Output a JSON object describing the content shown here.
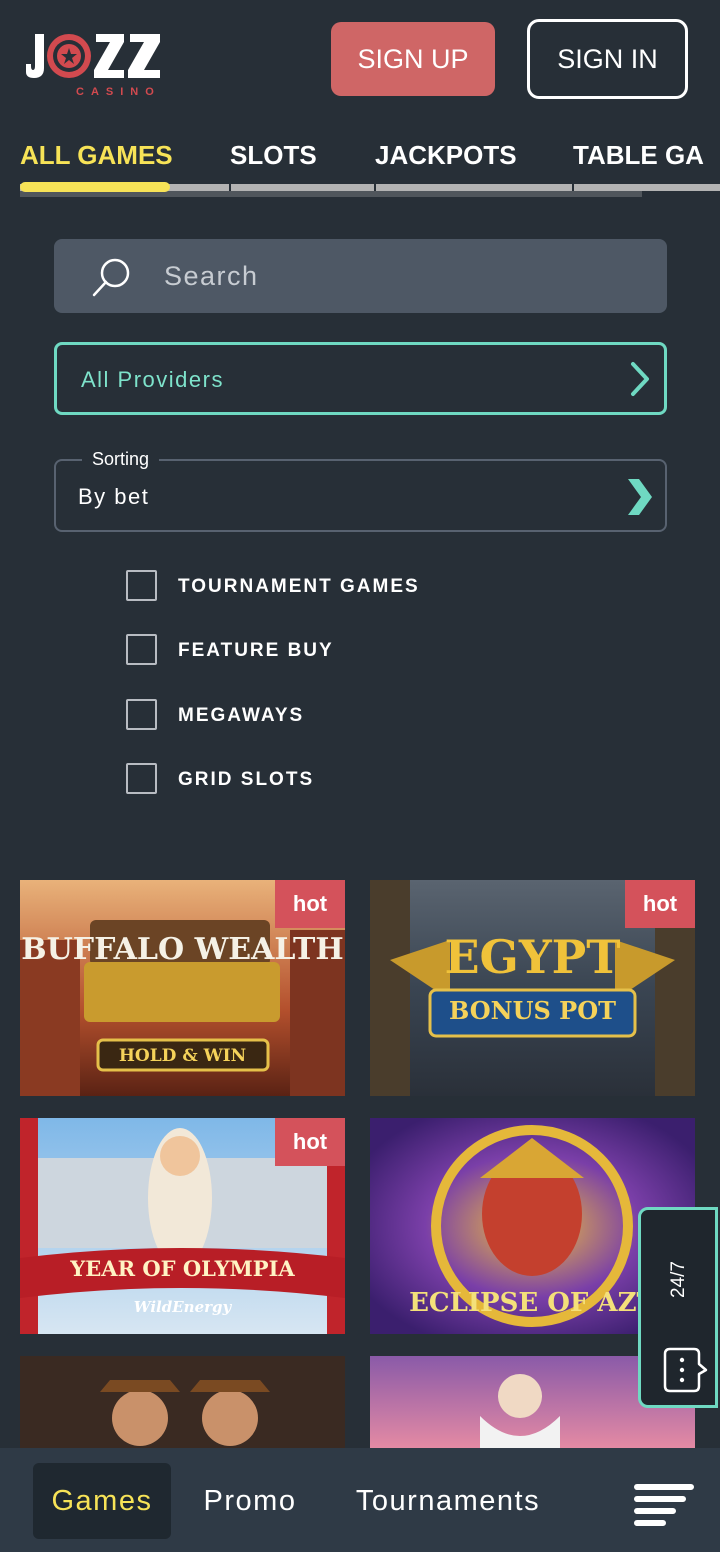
{
  "header": {
    "logo_text": "JOZZ",
    "logo_sub": "CASINO",
    "signup_label": "SIGN UP",
    "signin_label": "SIGN IN"
  },
  "tabs": [
    {
      "label": "ALL GAMES",
      "active": true
    },
    {
      "label": "SLOTS",
      "active": false
    },
    {
      "label": "JACKPOTS",
      "active": false
    },
    {
      "label": "TABLE GA",
      "active": false
    }
  ],
  "search": {
    "placeholder": "Search"
  },
  "providers": {
    "label": "All Providers"
  },
  "sorting": {
    "legend": "Sorting",
    "value": "By bet"
  },
  "filters": [
    {
      "label": "TOURNAMENT GAMES",
      "checked": false
    },
    {
      "label": "FEATURE BUY",
      "checked": false
    },
    {
      "label": "MEGAWAYS",
      "checked": false
    },
    {
      "label": "GRID SLOTS",
      "checked": false
    }
  ],
  "games": [
    {
      "title": "BUFFALO WEALTH",
      "subtitle": "HOLD & WIN",
      "badge": "hot"
    },
    {
      "title": "EGYPT",
      "subtitle": "BONUS POT",
      "badge": "hot"
    },
    {
      "title": "YEAR OF OLYMPIA",
      "subtitle": "WildEnergy",
      "badge": "hot"
    },
    {
      "title": "ECLIPSE OF AZT",
      "subtitle": "",
      "badge": ""
    },
    {
      "title": "",
      "subtitle": "",
      "badge": ""
    },
    {
      "title": "",
      "subtitle": "",
      "badge": ""
    }
  ],
  "support": {
    "label": "24/7"
  },
  "bottom_nav": {
    "games": "Games",
    "promo": "Promo",
    "tournaments": "Tournaments"
  },
  "colors": {
    "background": "#272f37",
    "accent_yellow": "#f7e357",
    "accent_teal": "#6fd9c2",
    "signup_red": "#cf6666",
    "hot_red": "#d4525b"
  }
}
